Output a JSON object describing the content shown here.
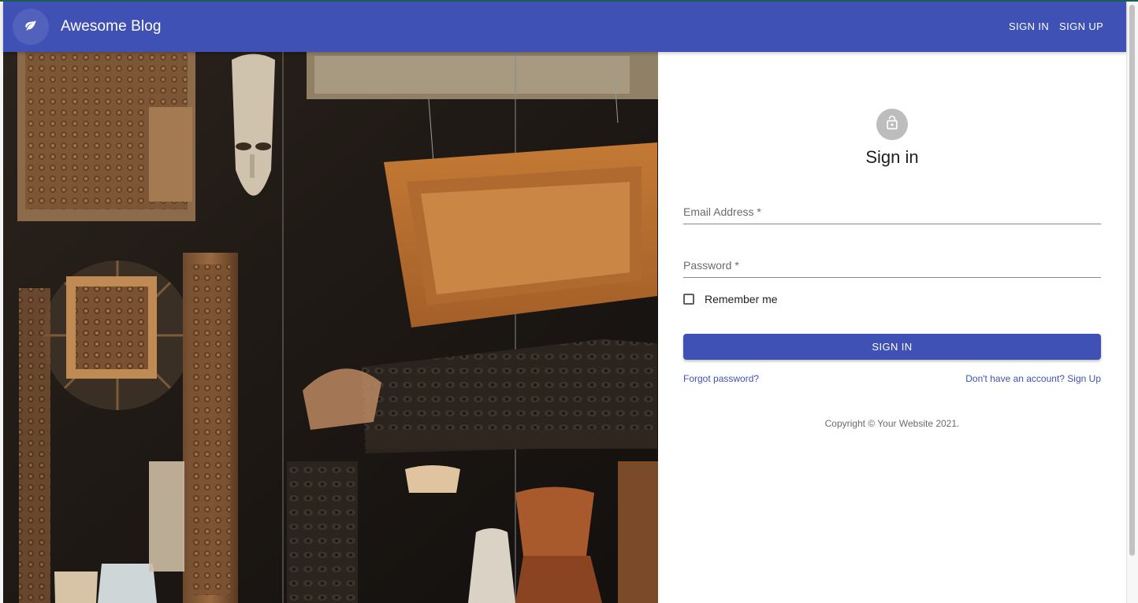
{
  "appbar": {
    "title": "Awesome Blog",
    "logo_icon": "leaf-icon",
    "background": "#3f51b5",
    "nav": {
      "signin_label": "SIGN IN",
      "signup_label": "SIGN UP"
    }
  },
  "hero": {
    "image": "dark shop window with carved wooden panels, mask, picture frames and pottery"
  },
  "form": {
    "avatar_icon": "lock-icon",
    "heading": "Sign in",
    "email": {
      "label": "Email Address *",
      "value": ""
    },
    "password": {
      "label": "Password *",
      "value": ""
    },
    "remember": {
      "label": "Remember me",
      "checked": false
    },
    "submit_label": "SIGN IN",
    "forgot_link": "Forgot password?",
    "signup_link": "Don't have an account? Sign Up",
    "copyright": "Copyright © Your Website 2021."
  },
  "colors": {
    "primary": "#3f51b5",
    "avatar": "#bdbdbd"
  }
}
